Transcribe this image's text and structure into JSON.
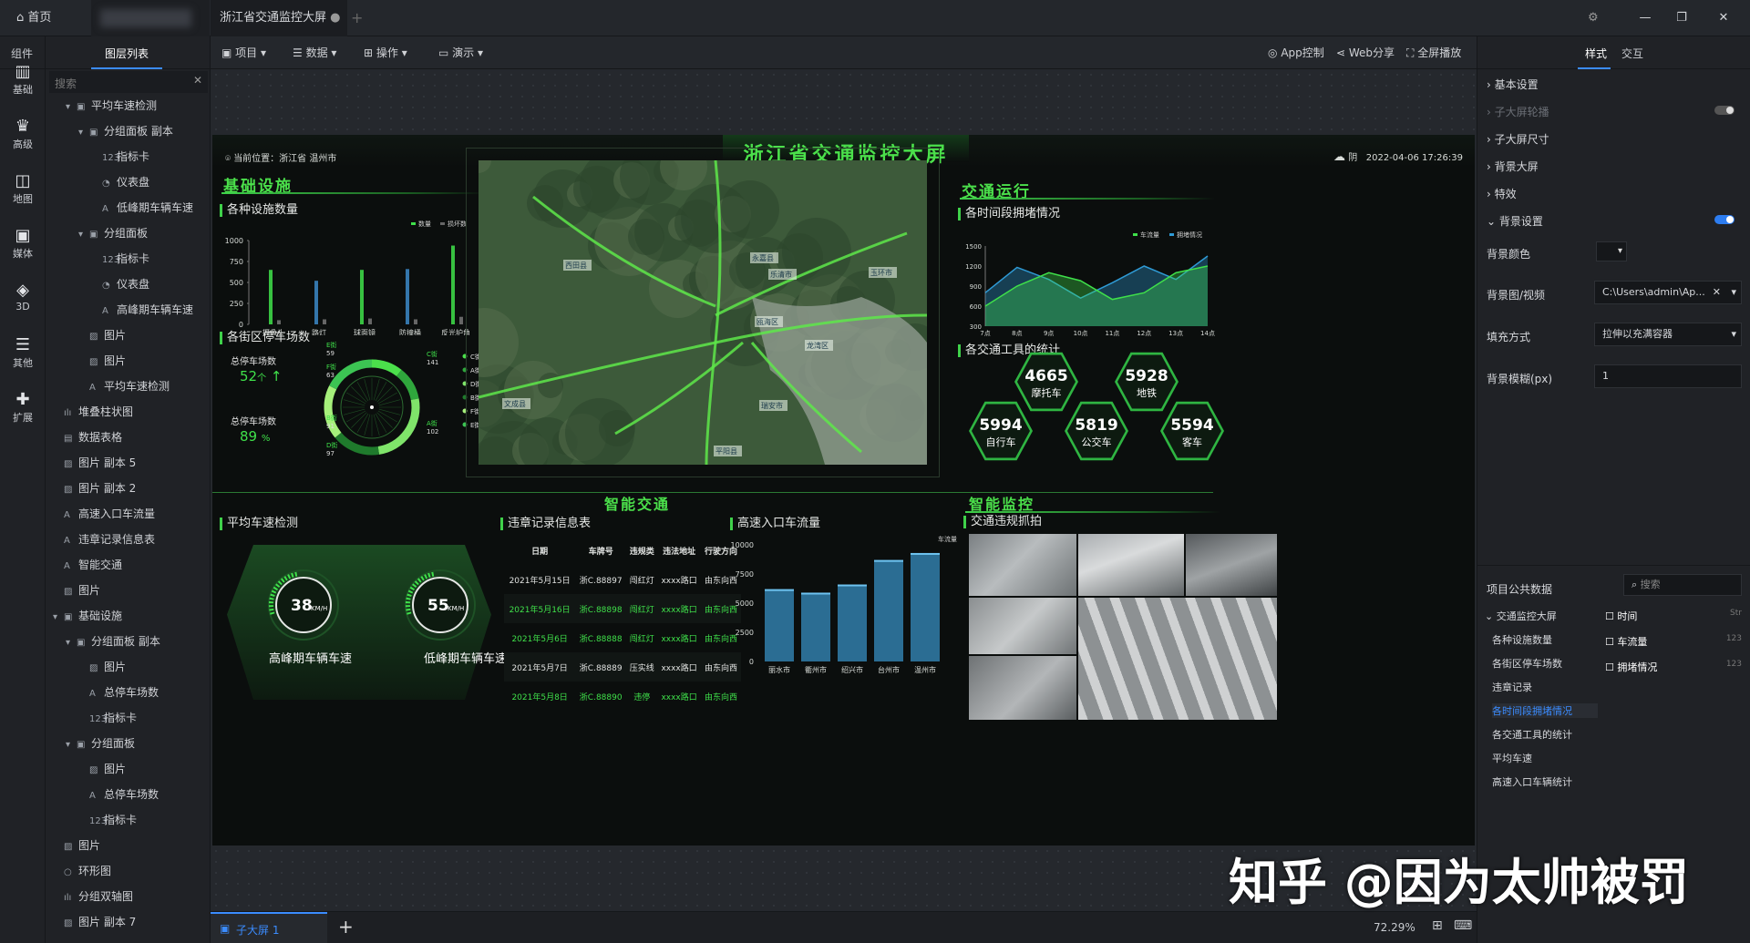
{
  "topbar": {
    "home": "首页",
    "doc_tab": "浙江省交通监控大屏",
    "min": "—",
    "max": "❐",
    "close": "✕"
  },
  "left_icons": [
    {
      "icon": "bar-chart-icon",
      "label": "基础"
    },
    {
      "icon": "crown-icon",
      "label": "高级"
    },
    {
      "icon": "map-icon",
      "label": "地图"
    },
    {
      "icon": "media-icon",
      "label": "媒体"
    },
    {
      "icon": "cube-icon",
      "label": "3D"
    },
    {
      "icon": "list-icon",
      "label": "其他"
    },
    {
      "icon": "puzzle-icon",
      "label": "扩展"
    }
  ],
  "panel_tabs": {
    "components": "组件",
    "layers": "图层列表"
  },
  "search": {
    "placeholder": "搜索"
  },
  "layers": [
    {
      "label": "平均车速检测",
      "indent": 1,
      "arrow": "▾",
      "ic": "▣"
    },
    {
      "label": "分组面板 副本",
      "indent": 2,
      "arrow": "▾",
      "ic": "▣"
    },
    {
      "label": "指标卡",
      "indent": 3,
      "arrow": "",
      "ic": "123"
    },
    {
      "label": "仪表盘",
      "indent": 3,
      "arrow": "",
      "ic": "◔"
    },
    {
      "label": "低峰期车辆车速",
      "indent": 3,
      "arrow": "",
      "ic": "A"
    },
    {
      "label": "分组面板",
      "indent": 2,
      "arrow": "▾",
      "ic": "▣"
    },
    {
      "label": "指标卡",
      "indent": 3,
      "arrow": "",
      "ic": "123"
    },
    {
      "label": "仪表盘",
      "indent": 3,
      "arrow": "",
      "ic": "◔"
    },
    {
      "label": "高峰期车辆车速",
      "indent": 3,
      "arrow": "",
      "ic": "A"
    },
    {
      "label": "图片",
      "indent": 2,
      "arrow": "",
      "ic": "▨"
    },
    {
      "label": "图片",
      "indent": 2,
      "arrow": "",
      "ic": "▨"
    },
    {
      "label": "平均车速检测",
      "indent": 2,
      "arrow": "",
      "ic": "A"
    },
    {
      "label": "堆叠柱状图",
      "indent": 0,
      "arrow": "",
      "ic": "ılı"
    },
    {
      "label": "数据表格",
      "indent": 0,
      "arrow": "",
      "ic": "▤"
    },
    {
      "label": "图片 副本 5",
      "indent": 0,
      "arrow": "",
      "ic": "▨"
    },
    {
      "label": "图片 副本 2",
      "indent": 0,
      "arrow": "",
      "ic": "▨"
    },
    {
      "label": "高速入口车流量",
      "indent": 0,
      "arrow": "",
      "ic": "A"
    },
    {
      "label": "违章记录信息表",
      "indent": 0,
      "arrow": "",
      "ic": "A"
    },
    {
      "label": "智能交通",
      "indent": 0,
      "arrow": "",
      "ic": "A"
    },
    {
      "label": "图片",
      "indent": 0,
      "arrow": "",
      "ic": "▨"
    },
    {
      "label": "基础设施",
      "indent": 0,
      "arrow": "▾",
      "ic": "▣"
    },
    {
      "label": "分组面板 副本",
      "indent": 1,
      "arrow": "▾",
      "ic": "▣"
    },
    {
      "label": "图片",
      "indent": 2,
      "arrow": "",
      "ic": "▨"
    },
    {
      "label": "总停车场数",
      "indent": 2,
      "arrow": "",
      "ic": "A"
    },
    {
      "label": "指标卡",
      "indent": 2,
      "arrow": "",
      "ic": "123"
    },
    {
      "label": "分组面板",
      "indent": 1,
      "arrow": "▾",
      "ic": "▣"
    },
    {
      "label": "图片",
      "indent": 2,
      "arrow": "",
      "ic": "▨"
    },
    {
      "label": "总停车场数",
      "indent": 2,
      "arrow": "",
      "ic": "A"
    },
    {
      "label": "指标卡",
      "indent": 2,
      "arrow": "",
      "ic": "123"
    },
    {
      "label": "图片",
      "indent": 0,
      "arrow": "",
      "ic": "▨"
    },
    {
      "label": "环形图",
      "indent": 0,
      "arrow": "",
      "ic": "○"
    },
    {
      "label": "分组双轴图",
      "indent": 0,
      "arrow": "",
      "ic": "ılı"
    },
    {
      "label": "图片 副本 7",
      "indent": 0,
      "arrow": "",
      "ic": "▨"
    }
  ],
  "toolbar": {
    "project": "项目",
    "data": "数据",
    "operate": "操作",
    "demo": "演示",
    "app": "App控制",
    "web": "Web分享",
    "fullscreen": "全屏播放"
  },
  "screen": {
    "title": "浙江省交通监控大屏",
    "location": "当前位置：浙江省 温州市",
    "weather": "阴",
    "datetime": "2022-04-06 17:26:39",
    "infra": {
      "title": "基础设施",
      "sub1": "各种设施数量",
      "legend": [
        "数量",
        "损坏数"
      ],
      "yticks": [
        "1000",
        "750",
        "500",
        "250",
        "0"
      ],
      "cats": [
        "摄像头",
        "路灯",
        "球面镜",
        "防撞桶",
        "反光护角"
      ],
      "sub2": "各街区停车场数",
      "p1_label": "总停车场数",
      "p1_value": "52",
      "p1_unit": "个",
      "p1_arrow": "↑",
      "p2_label": "总停车场数",
      "p2_value": "89",
      "p2_unit": "%",
      "ring_labels": [
        {
          "n": "E街",
          "v": "59"
        },
        {
          "n": "F街",
          "v": "63"
        },
        {
          "n": "C街",
          "v": "141"
        },
        {
          "n": "B街",
          "v": "91"
        },
        {
          "n": "A街",
          "v": "102"
        },
        {
          "n": "D街",
          "v": "97"
        }
      ],
      "ring_legend": [
        "C街",
        "A街",
        "D街",
        "B街",
        "F街",
        "E街"
      ]
    },
    "traffic": {
      "title": "交通运行",
      "sub1": "各时间段拥堵情况",
      "legend": [
        "车流量",
        "拥堵情况"
      ],
      "yticks": [
        "1500",
        "1200",
        "900",
        "600",
        "300"
      ],
      "xticks": [
        "7点",
        "8点",
        "9点",
        "10点",
        "11点",
        "12点",
        "13点",
        "14点"
      ],
      "sub2": "各交通工具的统计",
      "vehicles": [
        {
          "v": "4665",
          "n": "摩托车"
        },
        {
          "v": "5928",
          "n": "地铁"
        },
        {
          "v": "5994",
          "n": "自行车"
        },
        {
          "v": "5819",
          "n": "公交车"
        },
        {
          "v": "5594",
          "n": "客车"
        }
      ]
    },
    "smart": {
      "title": "智能交通",
      "sub1": "平均车速检测",
      "g1_value": "38",
      "g1_unit": "KM/H",
      "g1_label": "高峰期车辆车速",
      "g2_value": "55",
      "g2_unit": "KM/H",
      "g2_label": "低峰期车辆车速",
      "sub2": "违章记录信息表",
      "headers": [
        "日期",
        "车牌号",
        "违规类",
        "违法地址",
        "行驶方向"
      ],
      "rows": [
        [
          "2021年5月15日",
          "浙C.88897",
          "闯红灯",
          "xxxx路口",
          "由东向西"
        ],
        [
          "2021年5月16日",
          "浙C.88898",
          "闯红灯",
          "xxxx路口",
          "由东向西"
        ],
        [
          "2021年5月6日",
          "浙C.88888",
          "闯红灯",
          "xxxx路口",
          "由东向西"
        ],
        [
          "2021年5月7日",
          "浙C.88889",
          "压实线",
          "xxxx路口",
          "由东向西"
        ],
        [
          "2021年5月8日",
          "浙C.88890",
          "违停",
          "xxxx路口",
          "由东向西"
        ]
      ],
      "sub3": "高速入口车流量",
      "legend": "车流量",
      "yticks": [
        "10000",
        "7500",
        "5000",
        "2500",
        "0"
      ],
      "cats": [
        "丽水市",
        "衢州市",
        "绍兴市",
        "台州市",
        "温州市"
      ]
    },
    "monitor": {
      "title": "智能监控",
      "sub1": "交通违规抓拍"
    },
    "map_labels": [
      "西田县",
      "永嘉县",
      "乐清市",
      "玉环市",
      "文成县",
      "瑞安市",
      "平阳县",
      "龙湾区",
      "瓯海区"
    ]
  },
  "right": {
    "tabs": [
      "样式",
      "交互"
    ],
    "items": [
      "基本设置",
      "子大屏轮播",
      "子大屏尺寸",
      "背景大屏",
      "特效",
      "背景设置"
    ],
    "bg_color_label": "背景颜色",
    "bg_image_label": "背景图/视频",
    "bg_image_value": "C:\\Users\\admin\\Ap...",
    "fill_label": "填充方式",
    "fill_value": "拉伸以充满容器",
    "blur_label": "背景模糊(px)",
    "blur_value": "1",
    "public_data": "项目公共数据",
    "public_search": "搜索",
    "tree": [
      "交通监控大屏",
      "各种设施数量",
      "各街区停车场数",
      "违章记录",
      "各时间段拥堵情况",
      "各交通工具的统计",
      "平均车速",
      "高速入口车辆统计"
    ],
    "fields": [
      {
        "n": "时间",
        "t": "Str"
      },
      {
        "n": "车流量",
        "t": "123"
      },
      {
        "n": "拥堵情况",
        "t": "123"
      }
    ]
  },
  "bottom": {
    "subscreen": "子大屏 1",
    "zoom": "72.29%"
  },
  "watermark": "知乎 @因为太帅被罚",
  "chart_data": [
    {
      "type": "bar",
      "title": "各种设施数量",
      "categories": [
        "摄像头",
        "路灯",
        "球面镜",
        "防撞桶",
        "反光护角"
      ],
      "series": [
        {
          "name": "数量",
          "values": [
            650,
            520,
            650,
            660,
            940
          ]
        },
        {
          "name": "损坏数",
          "values": [
            50,
            60,
            70,
            60,
            90
          ]
        }
      ],
      "ylim": [
        0,
        1000
      ]
    },
    {
      "type": "pie",
      "title": "各街区停车场数",
      "categories": [
        "E街",
        "F街",
        "C街",
        "B街",
        "A街",
        "D街"
      ],
      "values": [
        59,
        63,
        141,
        91,
        102,
        97
      ]
    },
    {
      "type": "area",
      "title": "各时间段拥堵情况",
      "x": [
        "7点",
        "8点",
        "9点",
        "10点",
        "11点",
        "12点",
        "13点",
        "14点"
      ],
      "series": [
        {
          "name": "车流量",
          "values": [
            800,
            1180,
            1000,
            720,
            950,
            1200,
            1000,
            1350
          ]
        },
        {
          "name": "拥堵情况",
          "values": [
            600,
            900,
            1100,
            980,
            700,
            800,
            1100,
            1200
          ]
        }
      ],
      "ylim": [
        300,
        1500
      ]
    },
    {
      "type": "bar",
      "title": "高速入口车流量",
      "categories": [
        "丽水市",
        "衢州市",
        "绍兴市",
        "台州市",
        "温州市"
      ],
      "values": [
        6200,
        5900,
        6600,
        8700,
        9300
      ],
      "ylim": [
        0,
        10000
      ]
    }
  ]
}
